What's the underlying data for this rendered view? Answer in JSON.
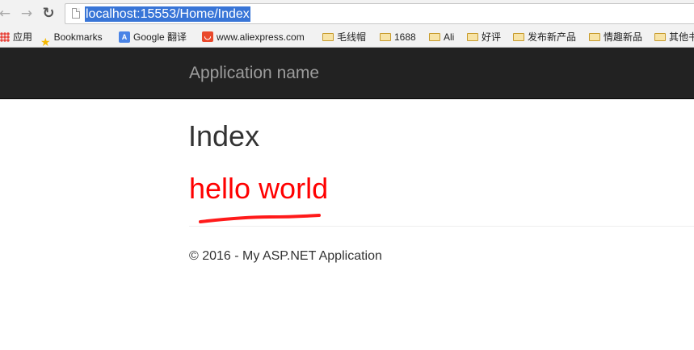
{
  "browser": {
    "url": "localhost:15553/Home/Index",
    "nav_back_icon": "back-arrow-icon",
    "nav_forward_icon": "forward-arrow-icon",
    "reload_icon": "reload-icon"
  },
  "bookmarks": [
    {
      "label": "应用",
      "icon": "apps-icon"
    },
    {
      "label": "Bookmarks",
      "icon": "star-icon"
    },
    {
      "label": "Google 翻译",
      "icon": "google-translate-icon"
    },
    {
      "label": "www.aliexpress.com",
      "icon": "aliexpress-icon"
    },
    {
      "label": "毛线帽",
      "icon": "folder-icon"
    },
    {
      "label": "1688",
      "icon": "folder-icon"
    },
    {
      "label": "Ali",
      "icon": "folder-icon"
    },
    {
      "label": "好评",
      "icon": "folder-icon"
    },
    {
      "label": "发布新产品",
      "icon": "folder-icon"
    },
    {
      "label": "情趣新品",
      "icon": "folder-icon"
    },
    {
      "label": "其他书",
      "icon": "folder-icon"
    }
  ],
  "navbar": {
    "brand": "Application name"
  },
  "main": {
    "title": "Index",
    "message": "hello world",
    "message_color": "#ff0000"
  },
  "footer": {
    "text": "© 2016 - My ASP.NET Application"
  },
  "colors": {
    "navbar_bg": "#222222",
    "brand_text": "#9d9d9d",
    "url_highlight": "#3875d7",
    "annotation_scribble": "#ff1a1a"
  }
}
